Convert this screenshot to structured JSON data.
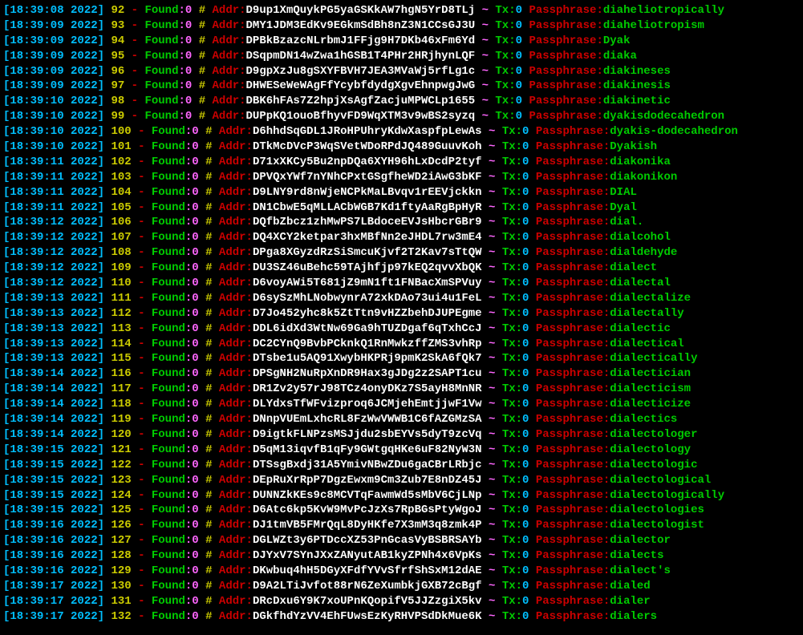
{
  "labels": {
    "found": "Found",
    "addr": "Addr",
    "tx": "Tx",
    "passphrase": "Passphrase"
  },
  "rows": [
    {
      "time": "18:39:08",
      "year": "2022",
      "idx": "92",
      "found": "0",
      "addr": "D9up1XmQuykPG5yaGSKkAW7hgN5YrD8TLj",
      "tx": "0",
      "pass": "diaheliotropically"
    },
    {
      "time": "18:39:09",
      "year": "2022",
      "idx": "93",
      "found": "0",
      "addr": "DMY1JDM3EdKv9EGkmSdBh8nZ3N1CCsGJ3U",
      "tx": "0",
      "pass": "diaheliotropism"
    },
    {
      "time": "18:39:09",
      "year": "2022",
      "idx": "94",
      "found": "0",
      "addr": "DPBkBzazcNLrbmJ1FFjg9H7DKb46xFm6Yd",
      "tx": "0",
      "pass": "Dyak"
    },
    {
      "time": "18:39:09",
      "year": "2022",
      "idx": "95",
      "found": "0",
      "addr": "DSqpmDN14wZwa1hGSB1T4PHr2HRjhynLQF",
      "tx": "0",
      "pass": "diaka"
    },
    {
      "time": "18:39:09",
      "year": "2022",
      "idx": "96",
      "found": "0",
      "addr": "D9gpXzJu8gSXYFBVH7JEA3MVaWj5rfLg1c",
      "tx": "0",
      "pass": "diakineses"
    },
    {
      "time": "18:39:09",
      "year": "2022",
      "idx": "97",
      "found": "0",
      "addr": "DHWESeWeWAgFfYcybfdydgXgvEhnpwgJwG",
      "tx": "0",
      "pass": "diakinesis"
    },
    {
      "time": "18:39:10",
      "year": "2022",
      "idx": "98",
      "found": "0",
      "addr": "DBK6hFAs7Z2hpjXsAgfZacjuMPWCLp1655",
      "tx": "0",
      "pass": "diakinetic"
    },
    {
      "time": "18:39:10",
      "year": "2022",
      "idx": "99",
      "found": "0",
      "addr": "DUPpKQ1ouoBfhyvFD9WqXTM3v9wBS2syzq",
      "tx": "0",
      "pass": "dyakisdodecahedron"
    },
    {
      "time": "18:39:10",
      "year": "2022",
      "idx": "100",
      "found": "0",
      "addr": "D6hhdSqGDL1JRoHPUhryKdwXaspfpLewAs",
      "tx": "0",
      "pass": "dyakis-dodecahedron"
    },
    {
      "time": "18:39:10",
      "year": "2022",
      "idx": "101",
      "found": "0",
      "addr": "DTkMcDVcP3WqSVetWDoRPdJQ489GuuvKoh",
      "tx": "0",
      "pass": "Dyakish"
    },
    {
      "time": "18:39:11",
      "year": "2022",
      "idx": "102",
      "found": "0",
      "addr": "D71xXKCy5Bu2npDQa6XYH96hLxDcdP2tyf",
      "tx": "0",
      "pass": "diakonika"
    },
    {
      "time": "18:39:11",
      "year": "2022",
      "idx": "103",
      "found": "0",
      "addr": "DPVQxYWf7nYNhCPxtGSgfheWD2iAwG3bKF",
      "tx": "0",
      "pass": "diakonikon"
    },
    {
      "time": "18:39:11",
      "year": "2022",
      "idx": "104",
      "found": "0",
      "addr": "D9LNY9rd8nWjeNCPkMaLBvqv1rEEVjckkn",
      "tx": "0",
      "pass": "DIAL"
    },
    {
      "time": "18:39:11",
      "year": "2022",
      "idx": "105",
      "found": "0",
      "addr": "DN1CbwE5qMLLACbWGB7Kd1ftyAaRgBpHyR",
      "tx": "0",
      "pass": "Dyal"
    },
    {
      "time": "18:39:12",
      "year": "2022",
      "idx": "106",
      "found": "0",
      "addr": "DQfbZbcz1zhMwPS7LBdoceEVJsHbcrGBr9",
      "tx": "0",
      "pass": "dial."
    },
    {
      "time": "18:39:12",
      "year": "2022",
      "idx": "107",
      "found": "0",
      "addr": "DQ4XCY2ketpar3hxMBfNn2eJHDL7rw3mE4",
      "tx": "0",
      "pass": "dialcohol"
    },
    {
      "time": "18:39:12",
      "year": "2022",
      "idx": "108",
      "found": "0",
      "addr": "DPga8XGyzdRzSiSmcuKjvf2T2Kav7sTtQW",
      "tx": "0",
      "pass": "dialdehyde"
    },
    {
      "time": "18:39:12",
      "year": "2022",
      "idx": "109",
      "found": "0",
      "addr": "DU3SZ46uBehc59TAjhfjp97kEQ2qvvXbQK",
      "tx": "0",
      "pass": "dialect"
    },
    {
      "time": "18:39:12",
      "year": "2022",
      "idx": "110",
      "found": "0",
      "addr": "D6voyAWi5T681jZ9mN1ft1FNBacXmSPVuy",
      "tx": "0",
      "pass": "dialectal"
    },
    {
      "time": "18:39:13",
      "year": "2022",
      "idx": "111",
      "found": "0",
      "addr": "D6sySzMhLNobwynrA72xkDAo73ui4u1FeL",
      "tx": "0",
      "pass": "dialectalize"
    },
    {
      "time": "18:39:13",
      "year": "2022",
      "idx": "112",
      "found": "0",
      "addr": "D7Jo452yhc8k5ZtTtn9vHZZbehDJUPEgme",
      "tx": "0",
      "pass": "dialectally"
    },
    {
      "time": "18:39:13",
      "year": "2022",
      "idx": "113",
      "found": "0",
      "addr": "DDL6idXd3WtNw69Ga9hTUZDgaf6qTxhCcJ",
      "tx": "0",
      "pass": "dialectic"
    },
    {
      "time": "18:39:13",
      "year": "2022",
      "idx": "114",
      "found": "0",
      "addr": "DC2CYnQ9BvbPCknkQ1RnMwkzffZMS3vhRp",
      "tx": "0",
      "pass": "dialectical"
    },
    {
      "time": "18:39:13",
      "year": "2022",
      "idx": "115",
      "found": "0",
      "addr": "DTsbe1u5AQ91XwybHKPRj9pmK2SkA6fQk7",
      "tx": "0",
      "pass": "dialectically"
    },
    {
      "time": "18:39:14",
      "year": "2022",
      "idx": "116",
      "found": "0",
      "addr": "DPSgNH2NuRpXnDR9Hax3gJDg2z2SAPT1cu",
      "tx": "0",
      "pass": "dialectician"
    },
    {
      "time": "18:39:14",
      "year": "2022",
      "idx": "117",
      "found": "0",
      "addr": "DR1Zv2y57rJ98TCz4onyDKz7S5ayH8MnNR",
      "tx": "0",
      "pass": "dialecticism"
    },
    {
      "time": "18:39:14",
      "year": "2022",
      "idx": "118",
      "found": "0",
      "addr": "DLYdxsTfWFvizproq6JCMjehEmtjjwF1Vw",
      "tx": "0",
      "pass": "dialecticize"
    },
    {
      "time": "18:39:14",
      "year": "2022",
      "idx": "119",
      "found": "0",
      "addr": "DNnpVUEmLxhcRL8FzWwVWWB1C6fAZGMzSA",
      "tx": "0",
      "pass": "dialectics"
    },
    {
      "time": "18:39:14",
      "year": "2022",
      "idx": "120",
      "found": "0",
      "addr": "D9igtkFLNPzsMSJjdu2sbEYVs5dyT9zcVq",
      "tx": "0",
      "pass": "dialectologer"
    },
    {
      "time": "18:39:15",
      "year": "2022",
      "idx": "121",
      "found": "0",
      "addr": "D5qM13iqvfB1qFy9GWtgqHKe6uF82NyW3N",
      "tx": "0",
      "pass": "dialectology"
    },
    {
      "time": "18:39:15",
      "year": "2022",
      "idx": "122",
      "found": "0",
      "addr": "DTSsgBxdj31A5YmivNBwZDu6gaCBrLRbjc",
      "tx": "0",
      "pass": "dialectologic"
    },
    {
      "time": "18:39:15",
      "year": "2022",
      "idx": "123",
      "found": "0",
      "addr": "DEpRuXrRpP7DgzEwxm9Cm3Zub7E8nDZ45J",
      "tx": "0",
      "pass": "dialectological"
    },
    {
      "time": "18:39:15",
      "year": "2022",
      "idx": "124",
      "found": "0",
      "addr": "DUNNZkKEs9c8MCVTqFawmWd5sMbV6CjLNp",
      "tx": "0",
      "pass": "dialectologically"
    },
    {
      "time": "18:39:15",
      "year": "2022",
      "idx": "125",
      "found": "0",
      "addr": "D6Atc6kp5KvW9MvPcJzXs7RpBGsPtyWgoJ",
      "tx": "0",
      "pass": "dialectologies"
    },
    {
      "time": "18:39:16",
      "year": "2022",
      "idx": "126",
      "found": "0",
      "addr": "DJ1tmVB5FMrQqL8DyHKfe7X3mM3q8zmk4P",
      "tx": "0",
      "pass": "dialectologist"
    },
    {
      "time": "18:39:16",
      "year": "2022",
      "idx": "127",
      "found": "0",
      "addr": "DGLWZt3y6PTDccXZ53PnGcasVyBSBRSAYb",
      "tx": "0",
      "pass": "dialector"
    },
    {
      "time": "18:39:16",
      "year": "2022",
      "idx": "128",
      "found": "0",
      "addr": "DJYxV7SYnJXxZANyutAB1kyZPNh4x6VpKs",
      "tx": "0",
      "pass": "dialects"
    },
    {
      "time": "18:39:16",
      "year": "2022",
      "idx": "129",
      "found": "0",
      "addr": "DKwbuq4hH5DGyXFdfYVvSfrfShSxM12dAE",
      "tx": "0",
      "pass": "dialect's"
    },
    {
      "time": "18:39:17",
      "year": "2022",
      "idx": "130",
      "found": "0",
      "addr": "D9A2LTiJvfot88rN6ZeXumbkjGXB72cBgf",
      "tx": "0",
      "pass": "dialed"
    },
    {
      "time": "18:39:17",
      "year": "2022",
      "idx": "131",
      "found": "0",
      "addr": "DRcDxu6Y9K7xoUPnKQopifV5JJZzgiX5kv",
      "tx": "0",
      "pass": "dialer"
    },
    {
      "time": "18:39:17",
      "year": "2022",
      "idx": "132",
      "found": "0",
      "addr": "DGkfhdYzVV4EhFUwsEzKyRHVPSdDkMue6K",
      "tx": "0",
      "pass": "dialers"
    }
  ]
}
